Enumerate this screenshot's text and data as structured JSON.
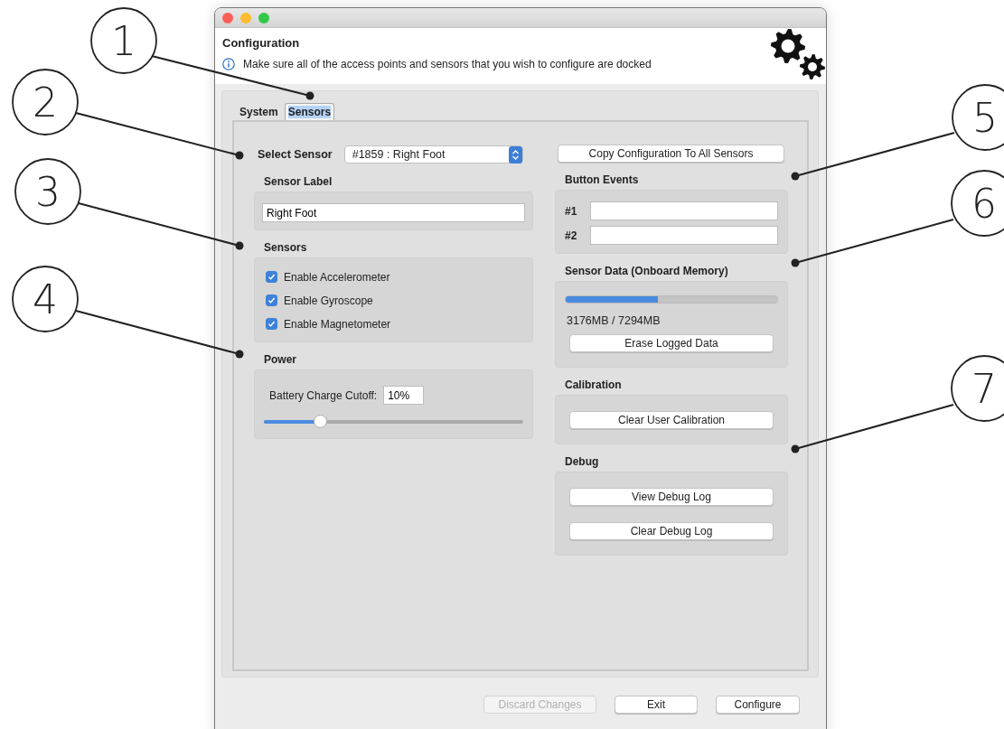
{
  "header": {
    "title": "Configuration",
    "info": "Make sure all of the access points and sensors that you wish to configure are docked"
  },
  "tabs": [
    {
      "label": "System",
      "selected": false
    },
    {
      "label": "Sensors",
      "selected": true
    }
  ],
  "select_sensor": {
    "label": "Select Sensor",
    "value": "#1859 : Right Foot"
  },
  "sensor_label": {
    "heading": "Sensor Label",
    "value": "Right Foot"
  },
  "sensors": {
    "heading": "Sensors",
    "options": [
      {
        "label": "Enable Accelerometer",
        "checked": true
      },
      {
        "label": "Enable Gyroscope",
        "checked": true
      },
      {
        "label": "Enable Magnetometer",
        "checked": true
      }
    ]
  },
  "power": {
    "heading": "Power",
    "cutoff_label": "Battery Charge Cutoff:",
    "cutoff_value": "10%",
    "slider": {
      "level": 0.22
    }
  },
  "copy_button": "Copy Configuration To All Sensors",
  "button_events": {
    "heading": "Button Events",
    "fields": [
      {
        "label": "#1"
      },
      {
        "label": "#2"
      }
    ]
  },
  "sensor_data": {
    "heading": "Sensor Data (Onboard Memory)",
    "usage": {
      "level": 0.435
    },
    "reading": "3176MB / 7294MB",
    "button": "Erase Logged Data"
  },
  "calibration": {
    "heading": "Calibration",
    "buttons": [
      "Clear User Calibration"
    ]
  },
  "debug": {
    "heading": "Debug",
    "buttons": [
      "View Debug Log",
      "Clear Debug Log"
    ]
  },
  "footer_buttons": [
    {
      "label": "Discard Changes",
      "disabled": true
    },
    {
      "label": "Exit",
      "disabled": false
    },
    {
      "label": "Configure",
      "disabled": false
    }
  ],
  "callouts": [
    "1",
    "2",
    "3",
    "4",
    "5",
    "6",
    "7"
  ]
}
